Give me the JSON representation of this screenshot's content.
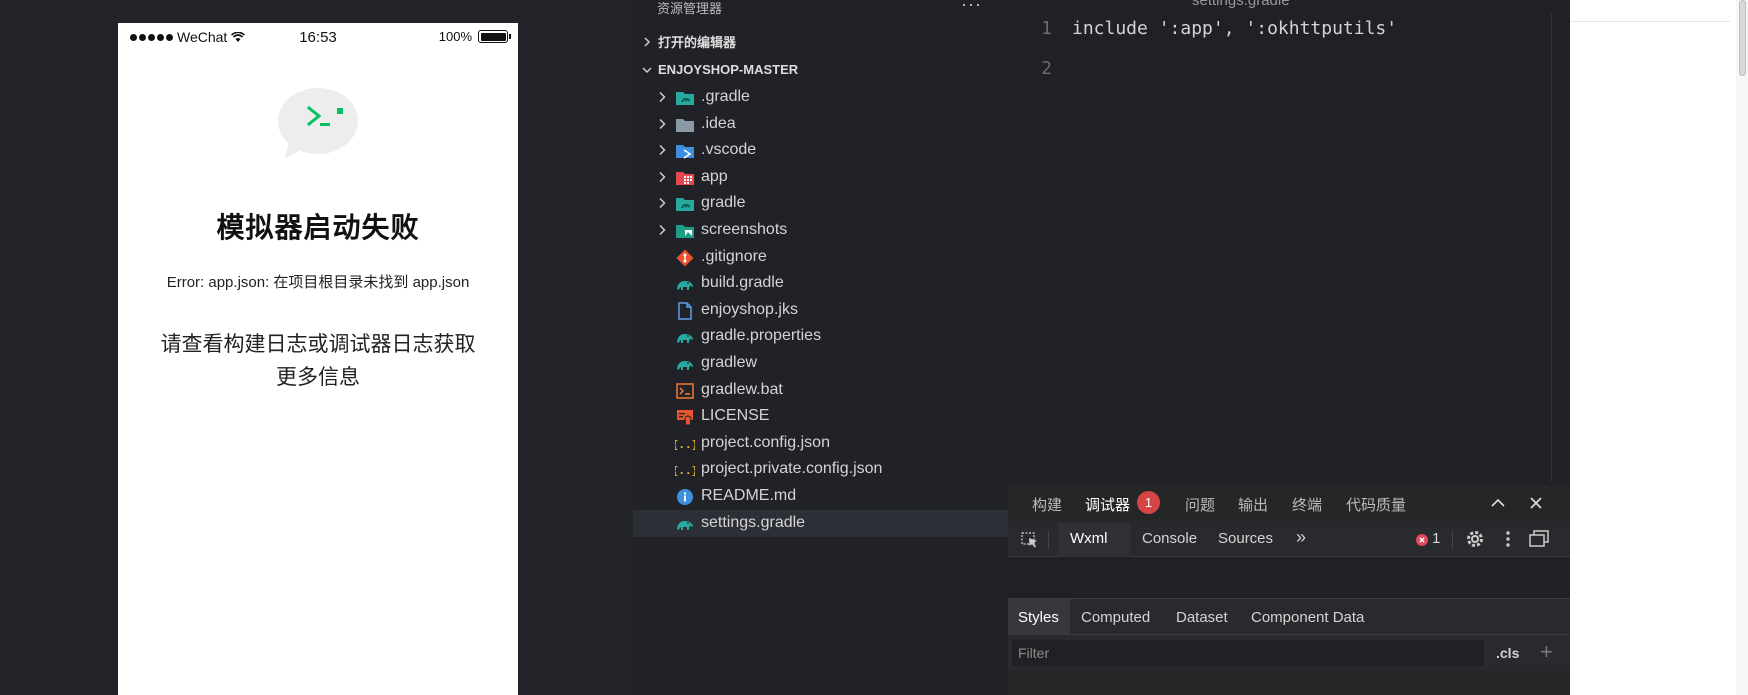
{
  "simulator": {
    "status": {
      "carrier": "WeChat",
      "time": "16:53",
      "battery": "100%"
    },
    "title": "模拟器启动失败",
    "error": "Error: app.json: 在项目根目录未找到 app.json",
    "hint": "请查看构建日志或调试器日志获取更多信息",
    "icon": "wechat-bubble-terminal-icon",
    "accent": "#07c160"
  },
  "explorer": {
    "header": "资源管理器",
    "more": "···",
    "sections": {
      "open_editors": "打开的编辑器",
      "root": "ENJOYSHOP-MASTER"
    },
    "items": [
      {
        "name": ".gradle",
        "kind": "folder",
        "icon": "folder-gradle-icon"
      },
      {
        "name": ".idea",
        "kind": "folder",
        "icon": "folder-icon"
      },
      {
        "name": ".vscode",
        "kind": "folder",
        "icon": "folder-vscode-icon"
      },
      {
        "name": "app",
        "kind": "folder",
        "icon": "folder-app-icon"
      },
      {
        "name": "gradle",
        "kind": "folder",
        "icon": "folder-gradle-icon"
      },
      {
        "name": "screenshots",
        "kind": "folder",
        "icon": "folder-images-icon"
      },
      {
        "name": ".gitignore",
        "kind": "file",
        "icon": "git-icon"
      },
      {
        "name": "build.gradle",
        "kind": "file",
        "icon": "gradle-elephant-icon"
      },
      {
        "name": "enjoyshop.jks",
        "kind": "file",
        "icon": "file-icon"
      },
      {
        "name": "gradle.properties",
        "kind": "file",
        "icon": "gradle-elephant-icon"
      },
      {
        "name": "gradlew",
        "kind": "file",
        "icon": "gradle-elephant-icon"
      },
      {
        "name": "gradlew.bat",
        "kind": "file",
        "icon": "terminal-icon"
      },
      {
        "name": "LICENSE",
        "kind": "file",
        "icon": "license-icon"
      },
      {
        "name": "project.config.json",
        "kind": "file",
        "icon": "json-icon"
      },
      {
        "name": "project.private.config.json",
        "kind": "file",
        "icon": "json-icon"
      },
      {
        "name": "README.md",
        "kind": "file",
        "icon": "info-icon"
      },
      {
        "name": "settings.gradle",
        "kind": "file",
        "icon": "gradle-elephant-icon",
        "selected": true
      }
    ]
  },
  "editor": {
    "tab": "settings.gradle",
    "lines": [
      {
        "num": "1",
        "text": "include ':app', ':okhttputils'"
      },
      {
        "num": "2",
        "text": ""
      }
    ]
  },
  "debugger": {
    "tabs": [
      "构建",
      "调试器",
      "问题",
      "输出",
      "终端",
      "代码质量"
    ],
    "active_tab": "调试器",
    "badge": "1",
    "devtools_tabs": [
      "Wxml",
      "Console",
      "Sources"
    ],
    "more_tabs": "»",
    "error_count": "1",
    "styles_tabs": [
      "Styles",
      "Computed",
      "Dataset",
      "Component Data"
    ],
    "filter_placeholder": "Filter",
    "cls_label": ".cls",
    "plus_label": "+"
  }
}
